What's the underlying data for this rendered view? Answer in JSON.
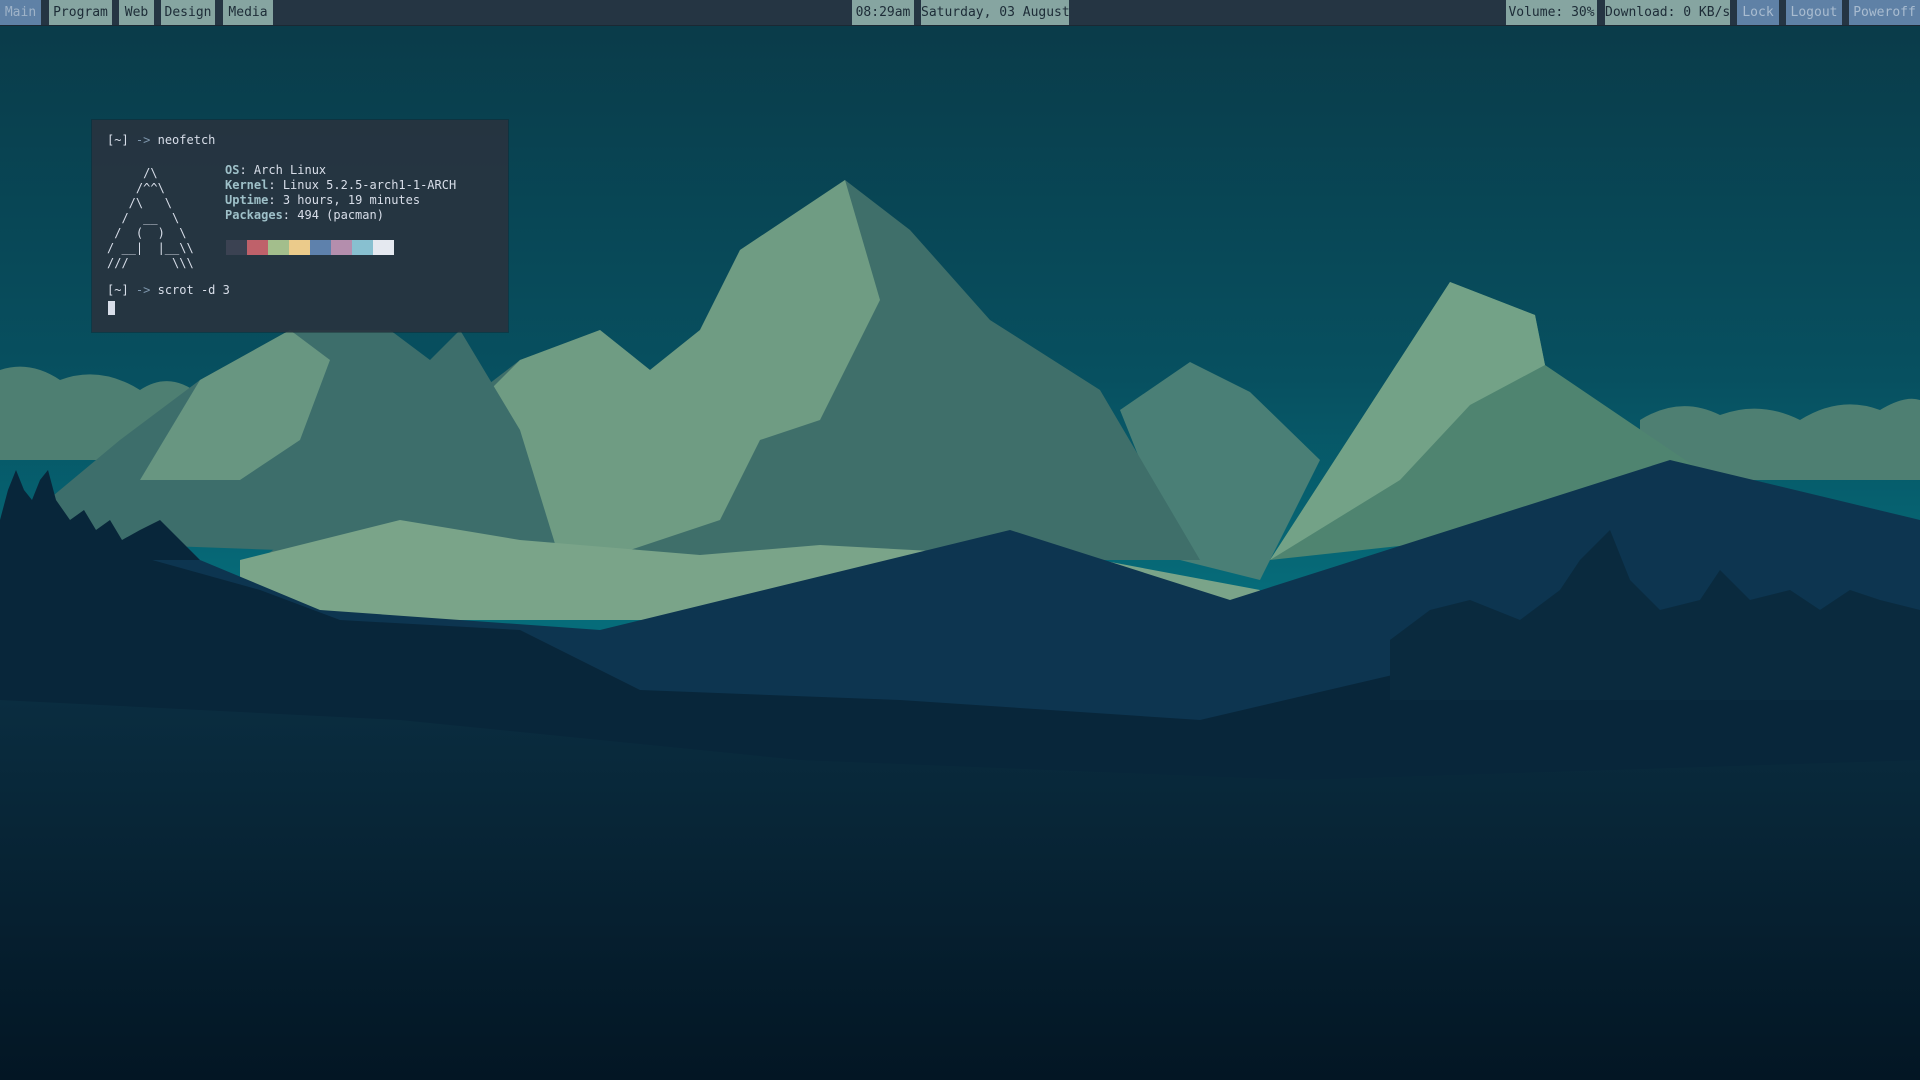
{
  "topbar": {
    "workspaces": [
      {
        "label": "Main",
        "active": true
      },
      {
        "label": "Program",
        "active": false
      },
      {
        "label": "Web",
        "active": false
      },
      {
        "label": "Design",
        "active": false
      },
      {
        "label": "Media",
        "active": false
      }
    ],
    "time": "08:29am",
    "date": "Saturday, 03 August",
    "volume": "Volume: 30%",
    "download": "Download: 0 KB/s",
    "lock": "Lock",
    "logout": "Logout",
    "poweroff": "Poweroff"
  },
  "terminal": {
    "prompt": "[~]",
    "arrow": "->",
    "command1": "neofetch",
    "command2": "scrot -d 3",
    "ascii_logo": "     /\\\n    /^^\\\n   /\\   \\\n  /  __  \\\n /  (  )  \\\n/ __|  |__\\\\\n///      \\\\\\",
    "info": [
      {
        "key": "OS",
        "value": " Arch Linux"
      },
      {
        "key": "Kernel",
        "value": " Linux 5.2.5-arch1-1-ARCH"
      },
      {
        "key": "Uptime",
        "value": " 3 hours, 19 minutes"
      },
      {
        "key": "Packages",
        "value": " 494 (pacman)"
      }
    ],
    "palette": [
      "#3b4252",
      "#bf616a",
      "#a3be8c",
      "#ebcb8b",
      "#5e81ac",
      "#b48ead",
      "#88c0d0",
      "#e5e9f0"
    ]
  },
  "colors": {
    "bar_bg": "#253543",
    "pill_light": "#86a5a1",
    "pill_accent": "#5f81a6",
    "terminal_bg": "#283440"
  }
}
